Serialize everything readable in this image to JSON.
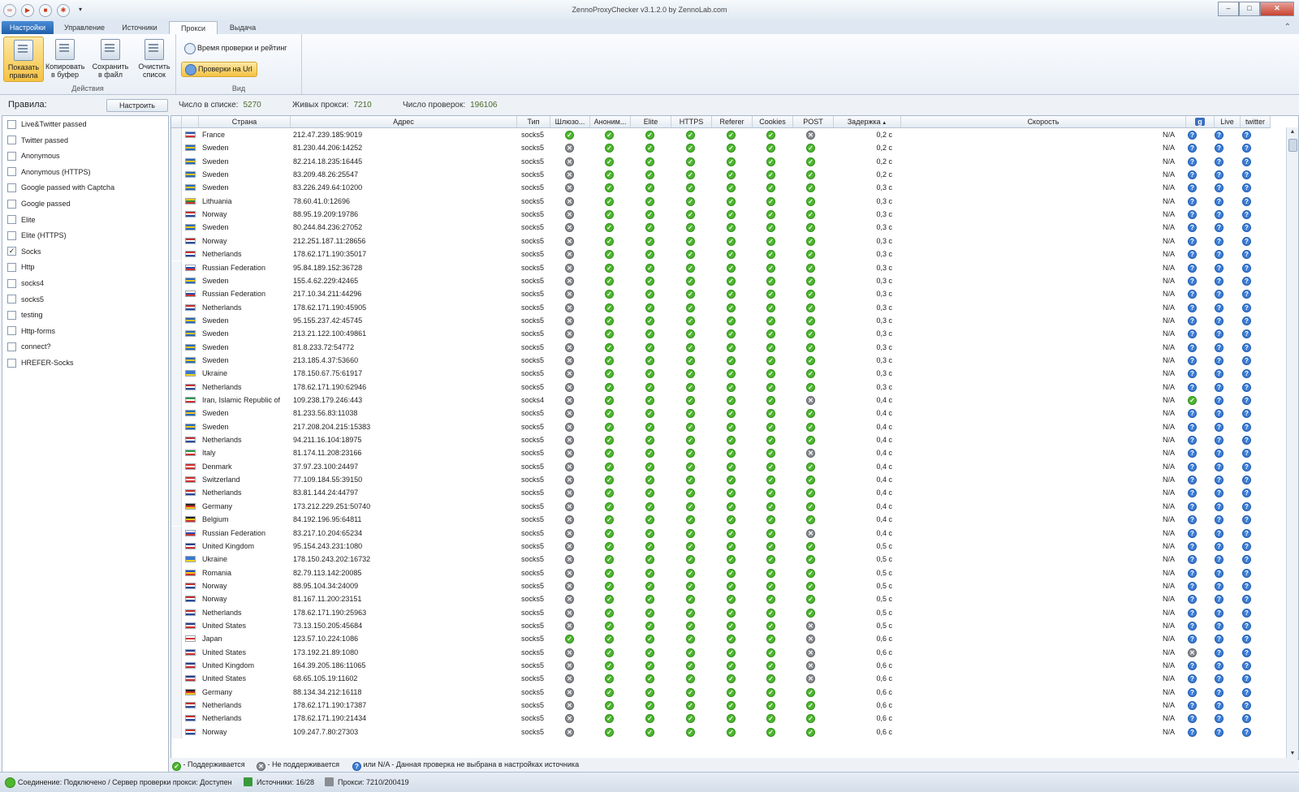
{
  "window": {
    "title": "ZennoProxyChecker v3.1.2.0 by ZennoLab.com",
    "min": "–",
    "max": "□",
    "close": "✕"
  },
  "tabs": {
    "app": "Настройки",
    "manage": "Управление",
    "sources": "Источники",
    "proxy": "Прокси",
    "output": "Выдача"
  },
  "ribbon": {
    "show_rules": "Показать правила",
    "copy_buffer": "Копировать в буфер",
    "save_file": "Сохранить в файл",
    "clear_list": "Очистить список",
    "actions_group": "Действия",
    "time_rating": "Время проверки и рейтинг",
    "url_checks": "Проверки на Url",
    "view_group": "Вид"
  },
  "infobar": {
    "rules_label": "Правила:",
    "configure": "Настроить",
    "count_label": "Число в списке:",
    "count_value": "5270",
    "alive_label": "Живых прокси:",
    "alive_value": "7210",
    "checks_label": "Число проверок:",
    "checks_value": "196106"
  },
  "rules": [
    {
      "label": "Live&Twitter passed",
      "checked": false
    },
    {
      "label": "Twitter passed",
      "checked": false
    },
    {
      "label": "Anonymous",
      "checked": false
    },
    {
      "label": "Anonymous (HTTPS)",
      "checked": false
    },
    {
      "label": "Google passed with Captcha",
      "checked": false
    },
    {
      "label": "Google passed",
      "checked": false
    },
    {
      "label": "Elite",
      "checked": false
    },
    {
      "label": "Elite (HTTPS)",
      "checked": false
    },
    {
      "label": "Socks",
      "checked": true
    },
    {
      "label": "Http",
      "checked": false
    },
    {
      "label": "socks4",
      "checked": false
    },
    {
      "label": "socks5",
      "checked": false
    },
    {
      "label": "testing",
      "checked": false
    },
    {
      "label": "Http-forms",
      "checked": false
    },
    {
      "label": "connect?",
      "checked": false
    },
    {
      "label": "HREFER-Socks",
      "checked": false
    }
  ],
  "columns": {
    "country": "Страна",
    "address": "Адрес",
    "type": "Тип",
    "gateway": "Шлюзо...",
    "anon": "Аноним...",
    "elite": "Elite",
    "https": "HTTPS",
    "referer": "Referer",
    "cookies": "Cookies",
    "post": "POST",
    "delay": "Задержка",
    "speed": "Скорость",
    "google": "g",
    "live": "Live",
    "twitter": "twitter"
  },
  "flag_colors": {
    "France": [
      "#2b57b4",
      "#ffffff",
      "#d9302c"
    ],
    "Sweden": [
      "#2a6ab8",
      "#f2c81a",
      "#2a6ab8"
    ],
    "Lithuania": [
      "#f2c81a",
      "#2d8a3e",
      "#c8302c"
    ],
    "Norway": [
      "#c8302c",
      "#ffffff",
      "#2a4a9c"
    ],
    "Netherlands": [
      "#c8302c",
      "#ffffff",
      "#2a4a9c"
    ],
    "Russian Federation": [
      "#ffffff",
      "#2a4ab0",
      "#d2302c"
    ],
    "Ukraine": [
      "#3a78d0",
      "#3a78d0",
      "#f2d21a"
    ],
    "Iran, Islamic Republic of": [
      "#2d9a45",
      "#ffffff",
      "#d2302c"
    ],
    "Italy": [
      "#2d9a45",
      "#ffffff",
      "#d2302c"
    ],
    "Denmark": [
      "#d2302c",
      "#ffffff",
      "#d2302c"
    ],
    "Switzerland": [
      "#d2302c",
      "#ffffff",
      "#d2302c"
    ],
    "Germany": [
      "#222222",
      "#d2302c",
      "#f2c81a"
    ],
    "Belgium": [
      "#222222",
      "#f2c81a",
      "#d2302c"
    ],
    "United Kingdom": [
      "#2a3f8c",
      "#ffffff",
      "#d2302c"
    ],
    "Romania": [
      "#2a4ab0",
      "#f2c81a",
      "#d2302c"
    ],
    "United States": [
      "#2a3f8c",
      "#ffffff",
      "#d2302c"
    ],
    "Japan": [
      "#ffffff",
      "#d2302c",
      "#ffffff"
    ]
  },
  "rows": [
    {
      "country": "France",
      "address": "212.47.239.185:9019",
      "type": "socks5",
      "gw": "ok",
      "post": "no",
      "delay": "0,2 c",
      "speed": "N/A",
      "g": "q"
    },
    {
      "country": "Sweden",
      "address": "81.230.44.206:14252",
      "type": "socks5",
      "gw": "no",
      "post": "ok",
      "delay": "0,2 c",
      "speed": "N/A",
      "g": "q"
    },
    {
      "country": "Sweden",
      "address": "82.214.18.235:16445",
      "type": "socks5",
      "gw": "no",
      "post": "ok",
      "delay": "0,2 c",
      "speed": "N/A",
      "g": "q"
    },
    {
      "country": "Sweden",
      "address": "83.209.48.26:25547",
      "type": "socks5",
      "gw": "no",
      "post": "ok",
      "delay": "0,2 c",
      "speed": "N/A",
      "g": "q"
    },
    {
      "country": "Sweden",
      "address": "83.226.249.64:10200",
      "type": "socks5",
      "gw": "no",
      "post": "ok",
      "delay": "0,3 c",
      "speed": "N/A",
      "g": "q"
    },
    {
      "country": "Lithuania",
      "address": "78.60.41.0:12696",
      "type": "socks5",
      "gw": "no",
      "post": "ok",
      "delay": "0,3 c",
      "speed": "N/A",
      "g": "q"
    },
    {
      "country": "Norway",
      "address": "88.95.19.209:19786",
      "type": "socks5",
      "gw": "no",
      "post": "ok",
      "delay": "0,3 c",
      "speed": "N/A",
      "g": "q"
    },
    {
      "country": "Sweden",
      "address": "80.244.84.236:27052",
      "type": "socks5",
      "gw": "no",
      "post": "ok",
      "delay": "0,3 c",
      "speed": "N/A",
      "g": "q"
    },
    {
      "country": "Norway",
      "address": "212.251.187.11:28656",
      "type": "socks5",
      "gw": "no",
      "post": "ok",
      "delay": "0,3 c",
      "speed": "N/A",
      "g": "q"
    },
    {
      "country": "Netherlands",
      "address": "178.62.171.190:35017",
      "type": "socks5",
      "gw": "no",
      "post": "ok",
      "delay": "0,3 c",
      "speed": "N/A",
      "g": "q"
    },
    {
      "country": "Russian Federation",
      "address": "95.84.189.152:36728",
      "type": "socks5",
      "gw": "no",
      "post": "ok",
      "delay": "0,3 c",
      "speed": "N/A",
      "g": "q"
    },
    {
      "country": "Sweden",
      "address": "155.4.62.229:42465",
      "type": "socks5",
      "gw": "no",
      "post": "ok",
      "delay": "0,3 c",
      "speed": "N/A",
      "g": "q"
    },
    {
      "country": "Russian Federation",
      "address": "217.10.34.211:44296",
      "type": "socks5",
      "gw": "no",
      "post": "ok",
      "delay": "0,3 c",
      "speed": "N/A",
      "g": "q"
    },
    {
      "country": "Netherlands",
      "address": "178.62.171.190:45905",
      "type": "socks5",
      "gw": "no",
      "post": "ok",
      "delay": "0,3 c",
      "speed": "N/A",
      "g": "q"
    },
    {
      "country": "Sweden",
      "address": "95.155.237.42:45745",
      "type": "socks5",
      "gw": "no",
      "post": "ok",
      "delay": "0,3 c",
      "speed": "N/A",
      "g": "q"
    },
    {
      "country": "Sweden",
      "address": "213.21.122.100:49861",
      "type": "socks5",
      "gw": "no",
      "post": "ok",
      "delay": "0,3 c",
      "speed": "N/A",
      "g": "q"
    },
    {
      "country": "Sweden",
      "address": "81.8.233.72:54772",
      "type": "socks5",
      "gw": "no",
      "post": "ok",
      "delay": "0,3 c",
      "speed": "N/A",
      "g": "q"
    },
    {
      "country": "Sweden",
      "address": "213.185.4.37:53660",
      "type": "socks5",
      "gw": "no",
      "post": "ok",
      "delay": "0,3 c",
      "speed": "N/A",
      "g": "q"
    },
    {
      "country": "Ukraine",
      "address": "178.150.67.75:61917",
      "type": "socks5",
      "gw": "no",
      "post": "ok",
      "delay": "0,3 c",
      "speed": "N/A",
      "g": "q"
    },
    {
      "country": "Netherlands",
      "address": "178.62.171.190:62946",
      "type": "socks5",
      "gw": "no",
      "post": "ok",
      "delay": "0,3 c",
      "speed": "N/A",
      "g": "q"
    },
    {
      "country": "Iran, Islamic Republic of",
      "address": "109.238.179.246:443",
      "type": "socks4",
      "gw": "no",
      "post": "no",
      "delay": "0,4 c",
      "speed": "N/A",
      "g": "ok"
    },
    {
      "country": "Sweden",
      "address": "81.233.56.83:11038",
      "type": "socks5",
      "gw": "no",
      "post": "ok",
      "delay": "0,4 c",
      "speed": "N/A",
      "g": "q"
    },
    {
      "country": "Sweden",
      "address": "217.208.204.215:15383",
      "type": "socks5",
      "gw": "no",
      "post": "ok",
      "delay": "0,4 c",
      "speed": "N/A",
      "g": "q"
    },
    {
      "country": "Netherlands",
      "address": "94.211.16.104:18975",
      "type": "socks5",
      "gw": "no",
      "post": "ok",
      "delay": "0,4 c",
      "speed": "N/A",
      "g": "q"
    },
    {
      "country": "Italy",
      "address": "81.174.11.208:23166",
      "type": "socks5",
      "gw": "no",
      "post": "no",
      "delay": "0,4 c",
      "speed": "N/A",
      "g": "q"
    },
    {
      "country": "Denmark",
      "address": "37.97.23.100:24497",
      "type": "socks5",
      "gw": "no",
      "post": "ok",
      "delay": "0,4 c",
      "speed": "N/A",
      "g": "q"
    },
    {
      "country": "Switzerland",
      "address": "77.109.184.55:39150",
      "type": "socks5",
      "gw": "no",
      "post": "ok",
      "delay": "0,4 c",
      "speed": "N/A",
      "g": "q"
    },
    {
      "country": "Netherlands",
      "address": "83.81.144.24:44797",
      "type": "socks5",
      "gw": "no",
      "post": "ok",
      "delay": "0,4 c",
      "speed": "N/A",
      "g": "q"
    },
    {
      "country": "Germany",
      "address": "173.212.229.251:50740",
      "type": "socks5",
      "gw": "no",
      "post": "ok",
      "delay": "0,4 c",
      "speed": "N/A",
      "g": "q"
    },
    {
      "country": "Belgium",
      "address": "84.192.196.95:64811",
      "type": "socks5",
      "gw": "no",
      "post": "ok",
      "delay": "0,4 c",
      "speed": "N/A",
      "g": "q"
    },
    {
      "country": "Russian Federation",
      "address": "83.217.10.204:65234",
      "type": "socks5",
      "gw": "no",
      "post": "no",
      "delay": "0,4 c",
      "speed": "N/A",
      "g": "q"
    },
    {
      "country": "United Kingdom",
      "address": "95.154.243.231:1080",
      "type": "socks5",
      "gw": "no",
      "post": "ok",
      "delay": "0,5 c",
      "speed": "N/A",
      "g": "q"
    },
    {
      "country": "Ukraine",
      "address": "178.150.243.202:16732",
      "type": "socks5",
      "gw": "no",
      "post": "ok",
      "delay": "0,5 c",
      "speed": "N/A",
      "g": "q"
    },
    {
      "country": "Romania",
      "address": "82.79.113.142:20085",
      "type": "socks5",
      "gw": "no",
      "post": "ok",
      "delay": "0,5 c",
      "speed": "N/A",
      "g": "q"
    },
    {
      "country": "Norway",
      "address": "88.95.104.34:24009",
      "type": "socks5",
      "gw": "no",
      "post": "ok",
      "delay": "0,5 c",
      "speed": "N/A",
      "g": "q"
    },
    {
      "country": "Norway",
      "address": "81.167.11.200:23151",
      "type": "socks5",
      "gw": "no",
      "post": "ok",
      "delay": "0,5 c",
      "speed": "N/A",
      "g": "q"
    },
    {
      "country": "Netherlands",
      "address": "178.62.171.190:25963",
      "type": "socks5",
      "gw": "no",
      "post": "ok",
      "delay": "0,5 c",
      "speed": "N/A",
      "g": "q"
    },
    {
      "country": "United States",
      "address": "73.13.150.205:45684",
      "type": "socks5",
      "gw": "no",
      "post": "no",
      "delay": "0,5 c",
      "speed": "N/A",
      "g": "q"
    },
    {
      "country": "Japan",
      "address": "123.57.10.224:1086",
      "type": "socks5",
      "gw": "ok",
      "post": "no",
      "delay": "0,6 c",
      "speed": "N/A",
      "g": "q"
    },
    {
      "country": "United States",
      "address": "173.192.21.89:1080",
      "type": "socks5",
      "gw": "no",
      "post": "no",
      "delay": "0,6 c",
      "speed": "N/A",
      "g": "no"
    },
    {
      "country": "United Kingdom",
      "address": "164.39.205.186:11065",
      "type": "socks5",
      "gw": "no",
      "post": "no",
      "delay": "0,6 c",
      "speed": "N/A",
      "g": "q"
    },
    {
      "country": "United States",
      "address": "68.65.105.19:11602",
      "type": "socks5",
      "gw": "no",
      "post": "no",
      "delay": "0,6 c",
      "speed": "N/A",
      "g": "q"
    },
    {
      "country": "Germany",
      "address": "88.134.34.212:16118",
      "type": "socks5",
      "gw": "no",
      "post": "ok",
      "delay": "0,6 c",
      "speed": "N/A",
      "g": "q"
    },
    {
      "country": "Netherlands",
      "address": "178.62.171.190:17387",
      "type": "socks5",
      "gw": "no",
      "post": "ok",
      "delay": "0,6 c",
      "speed": "N/A",
      "g": "q"
    },
    {
      "country": "Netherlands",
      "address": "178.62.171.190:21434",
      "type": "socks5",
      "gw": "no",
      "post": "ok",
      "delay": "0,6 c",
      "speed": "N/A",
      "g": "q"
    },
    {
      "country": "Norway",
      "address": "109.247.7.80:27303",
      "type": "socks5",
      "gw": "no",
      "post": "ok",
      "delay": "0,6 c",
      "speed": "N/A",
      "g": "q"
    }
  ],
  "legend": {
    "supported": "- Поддерживается",
    "not_supported": "- Не поддерживается",
    "not_selected": "или N/A - Данная проверка не выбрана в настройках источника"
  },
  "status": {
    "connection": "Соединение: Подключено / Сервер проверки прокси: Доступен",
    "sources": "Источники: 16/28",
    "proxies": "Прокси: 7210/200419"
  },
  "icon_glyphs": {
    "ok": "✓",
    "no": "✕",
    "q": "?"
  }
}
